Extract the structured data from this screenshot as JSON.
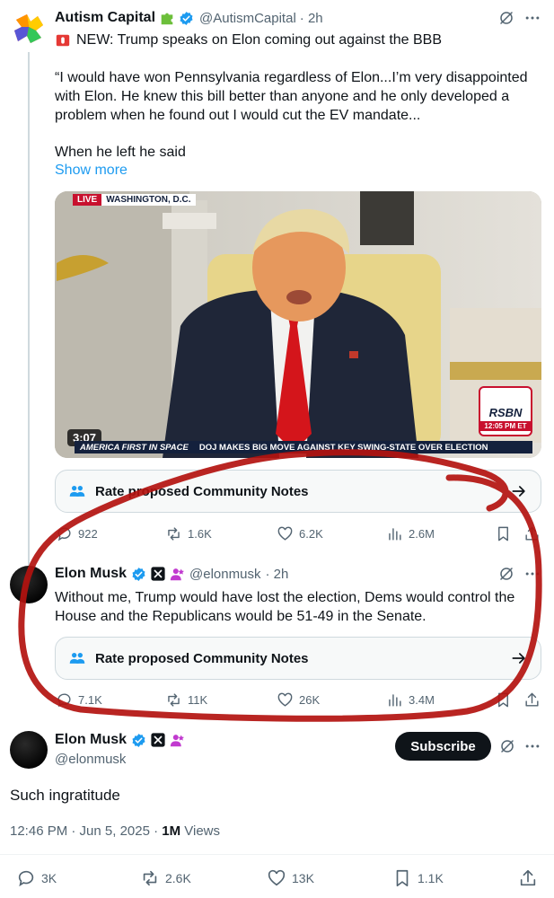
{
  "quoted_tweet": {
    "author_name": "Autism Capital",
    "handle": "@AutismCapital",
    "time": "· 2h",
    "headline": "NEW: Trump speaks on Elon coming out against the BBB",
    "quote_line1": "“I would have won Pennsylvania regardless of Elon...I’m very disappointed",
    "quote_line2": "with Elon. He knew this bill better than anyone and he only developed a",
    "quote_line3": "problem when he found out I would cut the EV mandate...",
    "quote_line4": "When he left he said",
    "show_more": "Show more",
    "video": {
      "live_badge": "LIVE",
      "location": "WASHINGTON, D.C.",
      "duration": "3:07",
      "network": "RSBN",
      "network_time": "12:05 PM ET",
      "ticker_left": "AMERICA FIRST IN SPACE",
      "ticker_right": "DOJ MAKES BIG MOVE AGAINST KEY SWING-STATE OVER ELECTION"
    },
    "community_notes": "Rate proposed Community Notes",
    "stats": {
      "replies": "922",
      "reposts": "1.6K",
      "likes": "6.2K",
      "views": "2.6M"
    }
  },
  "reply_tweet": {
    "author_name": "Elon Musk",
    "handle": "@elonmusk",
    "time": "· 2h",
    "line1": "Without me, Trump would have lost the election, Dems would control the",
    "line2": "House and the Republicans would be 51-49 in the Senate.",
    "community_notes": "Rate proposed Community Notes",
    "stats": {
      "replies": "7.1K",
      "reposts": "11K",
      "likes": "26K",
      "views": "3.4M"
    }
  },
  "main_tweet": {
    "author_name": "Elon Musk",
    "handle": "@elonmusk",
    "subscribe_label": "Subscribe",
    "text": "Such ingratitude",
    "timestamp": "12:46 PM · Jun 5, 2025 · ",
    "views_count": "1M",
    "views_label": " Views",
    "stats": {
      "replies": "3K",
      "reposts": "2.6K",
      "likes": "13K",
      "bookmarks": "1.1K"
    }
  },
  "colors": {
    "verified_blue": "#1d9bf0",
    "link_blue": "#1d9bf0",
    "annotation_red": "#b3120f",
    "muted": "#536471"
  }
}
